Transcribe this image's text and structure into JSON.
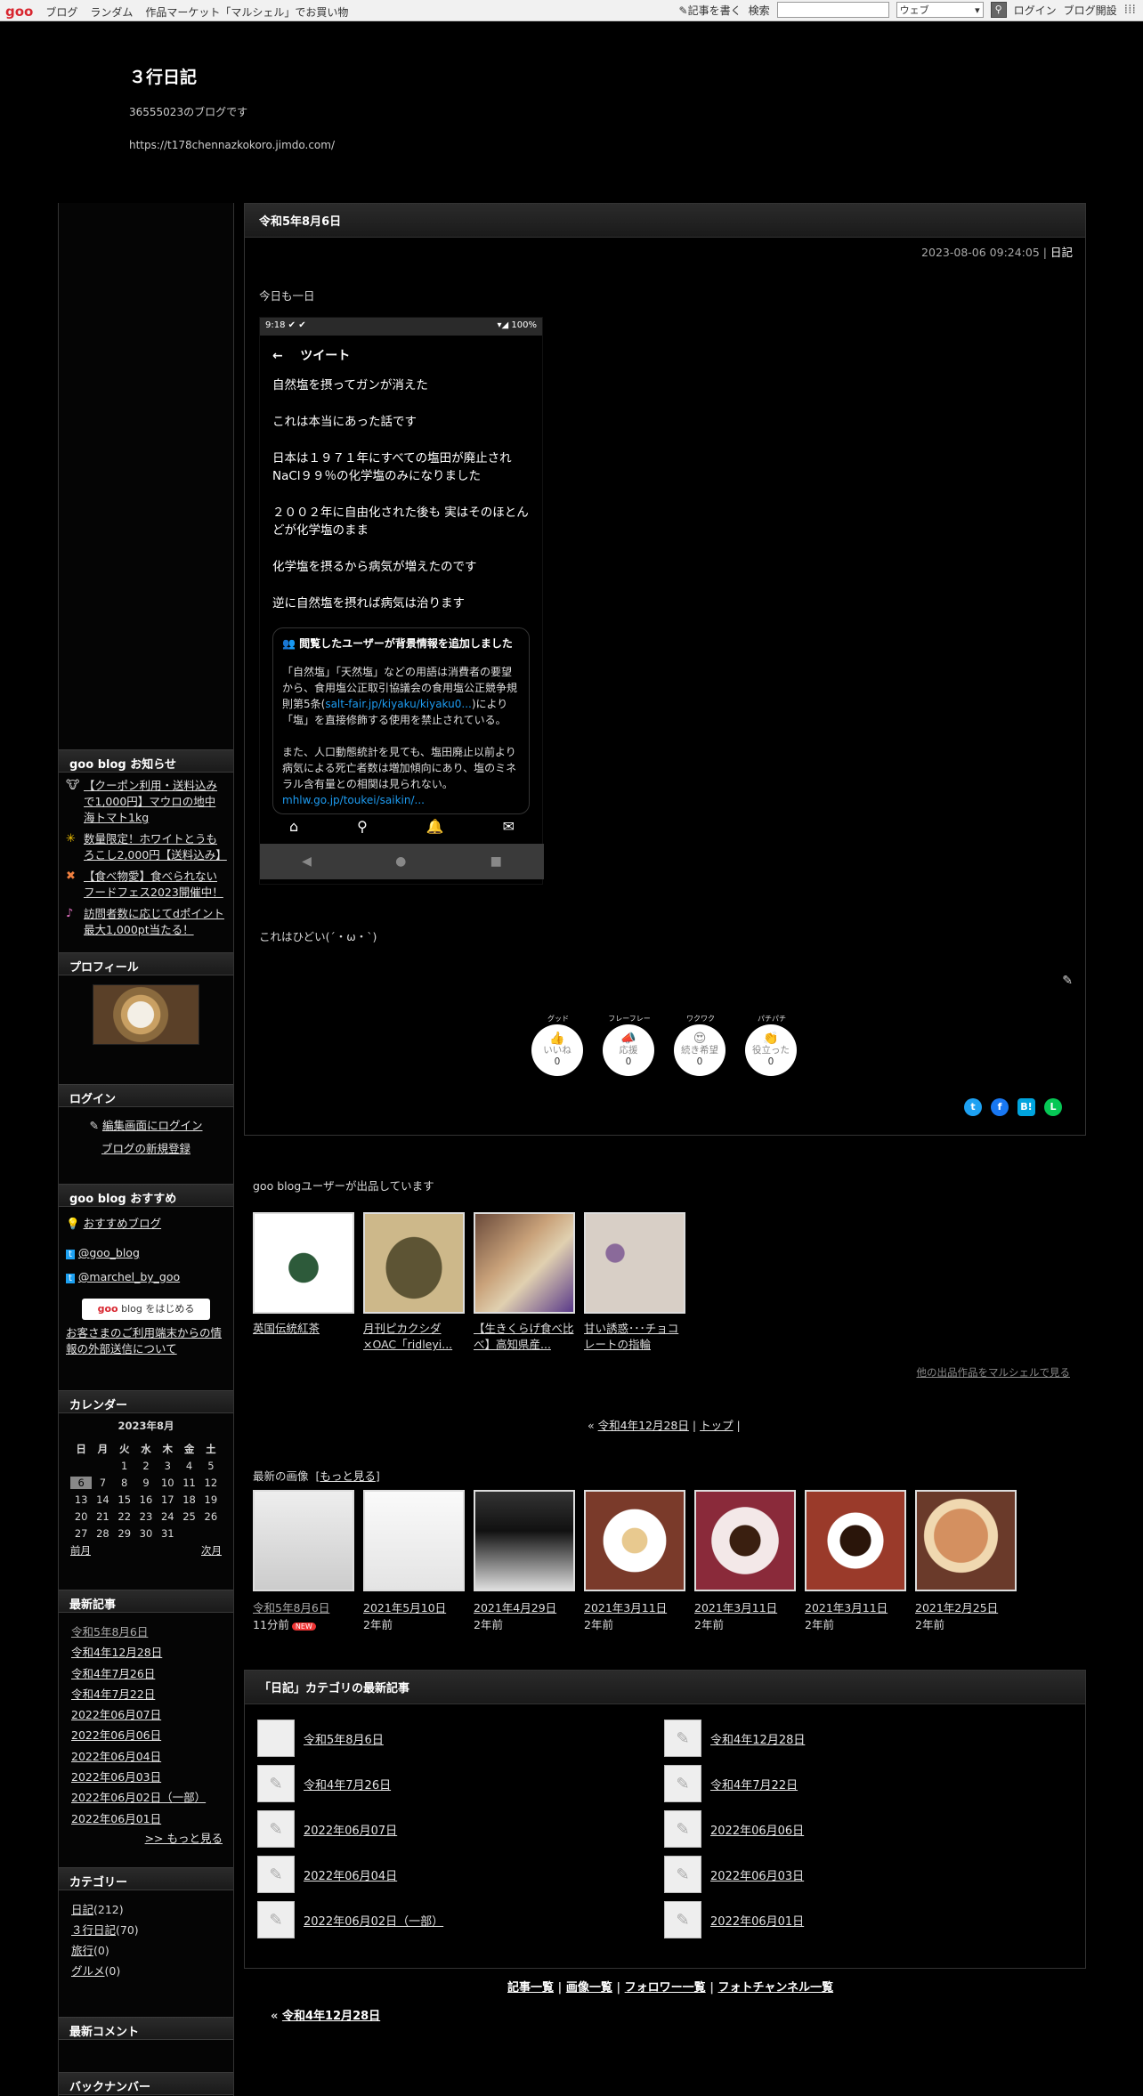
{
  "topbar": {
    "logo": "goo",
    "links": [
      "ブログ",
      "ランダム",
      "作品マーケット「マルシェル」でお買い物"
    ],
    "write": "記事を書く",
    "search_label": "検索",
    "search_value": "",
    "search_scope": "ウェブ",
    "login": "ログイン",
    "open_blog": "ブログ開設"
  },
  "blog": {
    "title": "３行日記",
    "desc": "36555023のブログです",
    "url": "https://t178chennazkokoro.jimdo.com/"
  },
  "sidebar": {
    "notices_title": "goo blog お知らせ",
    "notices": [
      {
        "icon": "🐮",
        "text": "【クーポン利用・送料込みで1,000円】マウロの地中海トマト1kg"
      },
      {
        "icon": "✳",
        "text": "数量限定！ホワイトとうもろこし2,000円【送料込み】"
      },
      {
        "icon": "✖",
        "text": "【食べ物愛】食べられないフードフェス2023開催中！"
      },
      {
        "icon": "♪",
        "text": "訪問者数に応じてdポイント最大1,000pt当たる！"
      }
    ],
    "profile_title": "プロフィール",
    "login_title": "ログイン",
    "login_edit": "編集画面にログイン",
    "login_new": "ブログの新規登録",
    "recommend_title": "goo blog おすすめ",
    "recommend": "おすすめブログ",
    "twitter1": "@goo_blog",
    "twitter2": "@marchel_by_goo",
    "start_btn_logo": "goo",
    "start_btn_text": "blog をはじめる",
    "foreign_notice": "お客さまのご利用端末からの情報の外部送信について",
    "calendar_title": "カレンダー",
    "month": "2023年8月",
    "weekdays": [
      "日",
      "月",
      "火",
      "水",
      "木",
      "金",
      "土"
    ],
    "days": [
      "",
      "",
      "1",
      "2",
      "3",
      "4",
      "5",
      "6",
      "7",
      "8",
      "9",
      "10",
      "11",
      "12",
      "13",
      "14",
      "15",
      "16",
      "17",
      "18",
      "19",
      "20",
      "21",
      "22",
      "23",
      "24",
      "25",
      "26",
      "27",
      "28",
      "29",
      "30",
      "31",
      "",
      ""
    ],
    "today": "6",
    "prev": "前月",
    "next": "次月",
    "recent_title": "最新記事",
    "recent": [
      "令和5年8月6日",
      "令和4年12月28日",
      "令和4年7月26日",
      "令和4年7月22日",
      "2022年06月07日",
      "2022年06月06日",
      "2022年06月04日",
      "2022年06月03日",
      "2022年06月02日（一部）",
      "2022年06月01日"
    ],
    "more": ">> もっと見る",
    "category_title": "カテゴリー",
    "categories": [
      {
        "name": "日記",
        "count": "(212)"
      },
      {
        "name": "３行日記",
        "count": "(70)"
      },
      {
        "name": "旅行",
        "count": "(0)"
      },
      {
        "name": "グルメ",
        "count": "(0)"
      }
    ],
    "comments_title": "最新コメント",
    "backnumber_title": "バックナンバー"
  },
  "post": {
    "title": "令和5年8月6日",
    "datetime": "2023-08-06 09:24:05",
    "sep": " | ",
    "category": "日記",
    "intro": "今日も一日",
    "outro": "これはひどい(´・ω・`)"
  },
  "tweet": {
    "time": "9:18",
    "status_icons": "✔ ✔",
    "battery": "▾◢ 100%",
    "back": "←",
    "header": "ツイート",
    "lines": [
      "自然塩を摂ってガンが消えた",
      "これは本当にあった話です",
      "日本は１９７１年にすべての塩田が廃止されNaCl９９％の化学塩のみになりました",
      "２００２年に自由化された後も 実はそのほとんどが化学塩のまま",
      "化学塩を摂るから病気が増えたのです",
      "逆に自然塩を摂れば病気は治ります"
    ],
    "note_title": "閲覧したユーザーが背景情報を追加しました",
    "note_p1a": "「自然塩」「天然塩」などの用語は消費者の要望から、食用塩公正取引協議会の食用塩公正競争規則第5条(",
    "note_link1": "salt-fair.jp/kiyaku/kiyaku0...",
    "note_p1b": ")により「塩」を直接修飾する使用を禁止されている。",
    "note_p2": "また、人口動態統計を見ても、塩田廃止以前より病気による死亡者数は増加傾向にあり、塩のミネラル含有量との相関は見られない。",
    "note_link2": "mhlw.go.jp/toukei/saikin/..."
  },
  "reactions": [
    {
      "top": "グッド",
      "emoji": "👍",
      "label": "いいね",
      "count": "0"
    },
    {
      "top": "フレーフレー",
      "emoji": "📣",
      "label": "応援",
      "count": "0"
    },
    {
      "top": "ワクワク",
      "emoji": "😍",
      "label": "続き希望",
      "count": "0"
    },
    {
      "top": "パチパチ",
      "emoji": "👏",
      "label": "役立った",
      "count": "0"
    }
  ],
  "share": [
    {
      "label": "t",
      "color": "#1da1f2"
    },
    {
      "label": "f",
      "color": "#1877f2"
    },
    {
      "label": "B!",
      "color": "#00a4de"
    },
    {
      "label": "L",
      "color": "#06c755"
    }
  ],
  "marche": {
    "heading": "goo blogユーザーが出品しています",
    "items": [
      "英国伝統紅茶",
      "月刊ピカクシダ×OAC「ridleyi...",
      "【生きくらげ食べ比べ】高知県産...",
      "甘い誘惑･･･チョコレートの指輪"
    ],
    "more": "他の出品作品をマルシェルで見る"
  },
  "pager": {
    "prev": "« ",
    "prev_link": "令和4年12月28日",
    "top": "トップ",
    "sep": " | "
  },
  "latest_images": {
    "heading": "最新の画像",
    "more": "もっと見る",
    "items": [
      {
        "date": "令和5年8月6日",
        "ago": "11分前",
        "new": "NEW"
      },
      {
        "date": "2021年5月10日",
        "ago": "2年前"
      },
      {
        "date": "2021年4月29日",
        "ago": "2年前"
      },
      {
        "date": "2021年3月11日",
        "ago": "2年前"
      },
      {
        "date": "2021年3月11日",
        "ago": "2年前"
      },
      {
        "date": "2021年3月11日",
        "ago": "2年前"
      },
      {
        "date": "2021年2月25日",
        "ago": "2年前"
      }
    ]
  },
  "category_box": {
    "title": "「日記」カテゴリの最新記事",
    "items": [
      "令和5年8月6日",
      "令和4年12月28日",
      "令和4年7月26日",
      "令和4年7月22日",
      "2022年06月07日",
      "2022年06月06日",
      "2022年06月04日",
      "2022年06月03日",
      "2022年06月02日（一部）",
      "2022年06月01日"
    ]
  },
  "footer": {
    "links": [
      "記事一覧",
      "画像一覧",
      "フォロワー一覧",
      "フォトチャンネル一覧"
    ],
    "prev": "令和4年12月28日"
  }
}
